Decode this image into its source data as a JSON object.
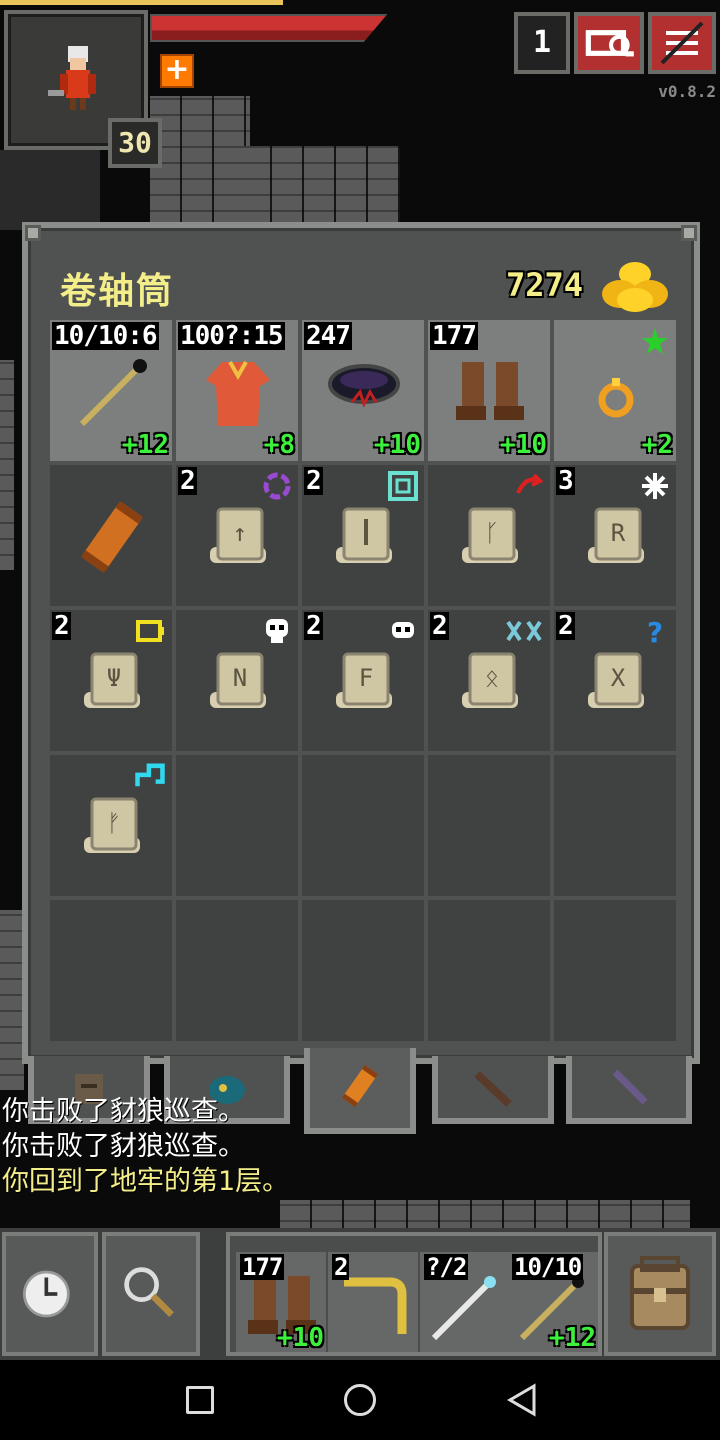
{
  "hud": {
    "depth": "30",
    "journal_count": "1",
    "version": "v0.8.2",
    "hp_fraction": 0.95
  },
  "bag": {
    "title": "卷轴筒",
    "gold": "7274",
    "slots": [
      {
        "top_label": "10/10:6",
        "bottom_label": "+12",
        "icon": "wand-icon",
        "equipped": true
      },
      {
        "top_label": "100?:15",
        "bottom_label": "+8",
        "icon": "robe-armor-icon",
        "equipped": true
      },
      {
        "top_label": "247",
        "bottom_label": "+10",
        "icon": "cloak-artifact-icon",
        "equipped": true
      },
      {
        "top_label": "177",
        "bottom_label": "+10",
        "icon": "boots-icon",
        "equipped": true
      },
      {
        "top_label": "",
        "bottom_label": "+2",
        "icon": "ring-icon",
        "equipped": true,
        "status": "green-star-icon"
      },
      {
        "top_label": "",
        "bottom_label": "",
        "icon": "scroll-holder-icon"
      },
      {
        "top_label": "2",
        "bottom_label": "",
        "icon": "scroll-icon",
        "status": "purple-swirl-icon"
      },
      {
        "top_label": "2",
        "bottom_label": "",
        "icon": "scroll-icon",
        "status": "teal-square-icon"
      },
      {
        "top_label": "",
        "bottom_label": "",
        "icon": "scroll-icon",
        "status": "red-arrow-icon"
      },
      {
        "top_label": "3",
        "bottom_label": "",
        "icon": "scroll-icon",
        "status": "white-star-icon"
      },
      {
        "top_label": "2",
        "bottom_label": "",
        "icon": "scroll-icon",
        "status": "yellow-battery-icon"
      },
      {
        "top_label": "",
        "bottom_label": "",
        "icon": "scroll-icon",
        "status": "skull-icon"
      },
      {
        "top_label": "2",
        "bottom_label": "",
        "icon": "scroll-icon",
        "status": "skull-icon"
      },
      {
        "top_label": "2",
        "bottom_label": "",
        "icon": "scroll-icon",
        "status": "teal-bones-icon"
      },
      {
        "top_label": "2",
        "bottom_label": "",
        "icon": "scroll-icon",
        "status": "blue-question-icon"
      },
      {
        "top_label": "",
        "bottom_label": "",
        "icon": "scroll-icon",
        "status": "cyan-note-icon"
      }
    ]
  },
  "tabs": [
    "backpack-tab-icon",
    "pouch-tab-icon",
    "scroll-holder-tab-icon",
    "quiver-tab-icon",
    "wand-holster-tab-icon"
  ],
  "log": {
    "line1": "你击败了豺狼巡查。",
    "line2": "你击败了豺狼巡查。",
    "line3": "你回到了地牢的第1层。"
  },
  "quickslots": [
    {
      "top_label": "177",
      "bottom_label": "+10",
      "icon": "boots-icon"
    },
    {
      "top_label": "2",
      "bottom_label": "",
      "icon": "boomerang-icon"
    },
    {
      "top_label": "?/2",
      "bottom_label": "",
      "icon": "wand-icon"
    },
    {
      "top_label": "10/10",
      "bottom_label": "+12",
      "icon": "wand-icon"
    }
  ],
  "colors": {
    "title": "#f4ee8a",
    "bonus": "#3cf03c",
    "log_highlight": "#f4ee8a"
  }
}
